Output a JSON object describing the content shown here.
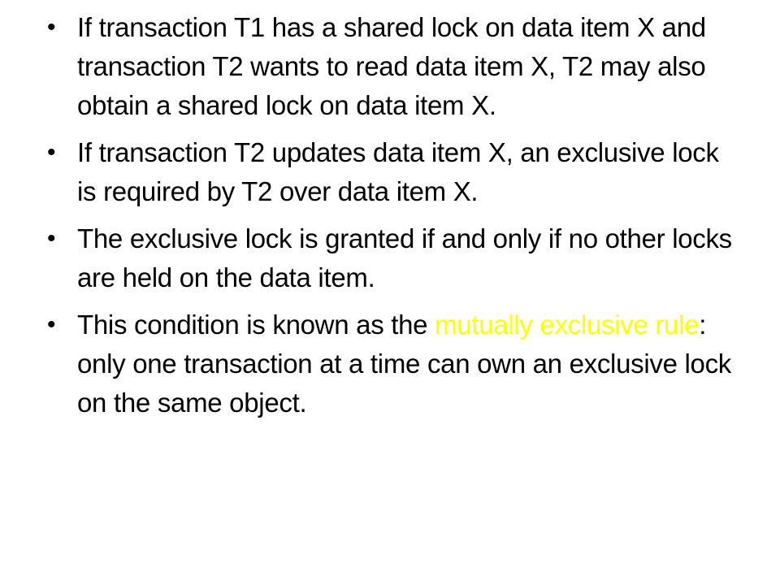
{
  "slide": {
    "bullet_symbol": "•",
    "highlight_color": "#ffff00",
    "text_color": "#000000",
    "background_color": "#ffffff",
    "bullets": [
      {
        "text": "If transaction T1 has a shared lock on data item X and transaction T2 wants to read data item X, T2 may also obtain a shared lock on data item X."
      },
      {
        "text": "If transaction T2 updates data item X, an exclusive lock is required by T2 over data item X."
      },
      {
        "text": "The exclusive lock is granted if and only if no other locks are held on the data item."
      },
      {
        "text_before": "This condition is known as the ",
        "highlight": "mutually exclusive rule",
        "text_after": ": only one transaction at a time can own an exclusive lock on the same object."
      }
    ]
  }
}
